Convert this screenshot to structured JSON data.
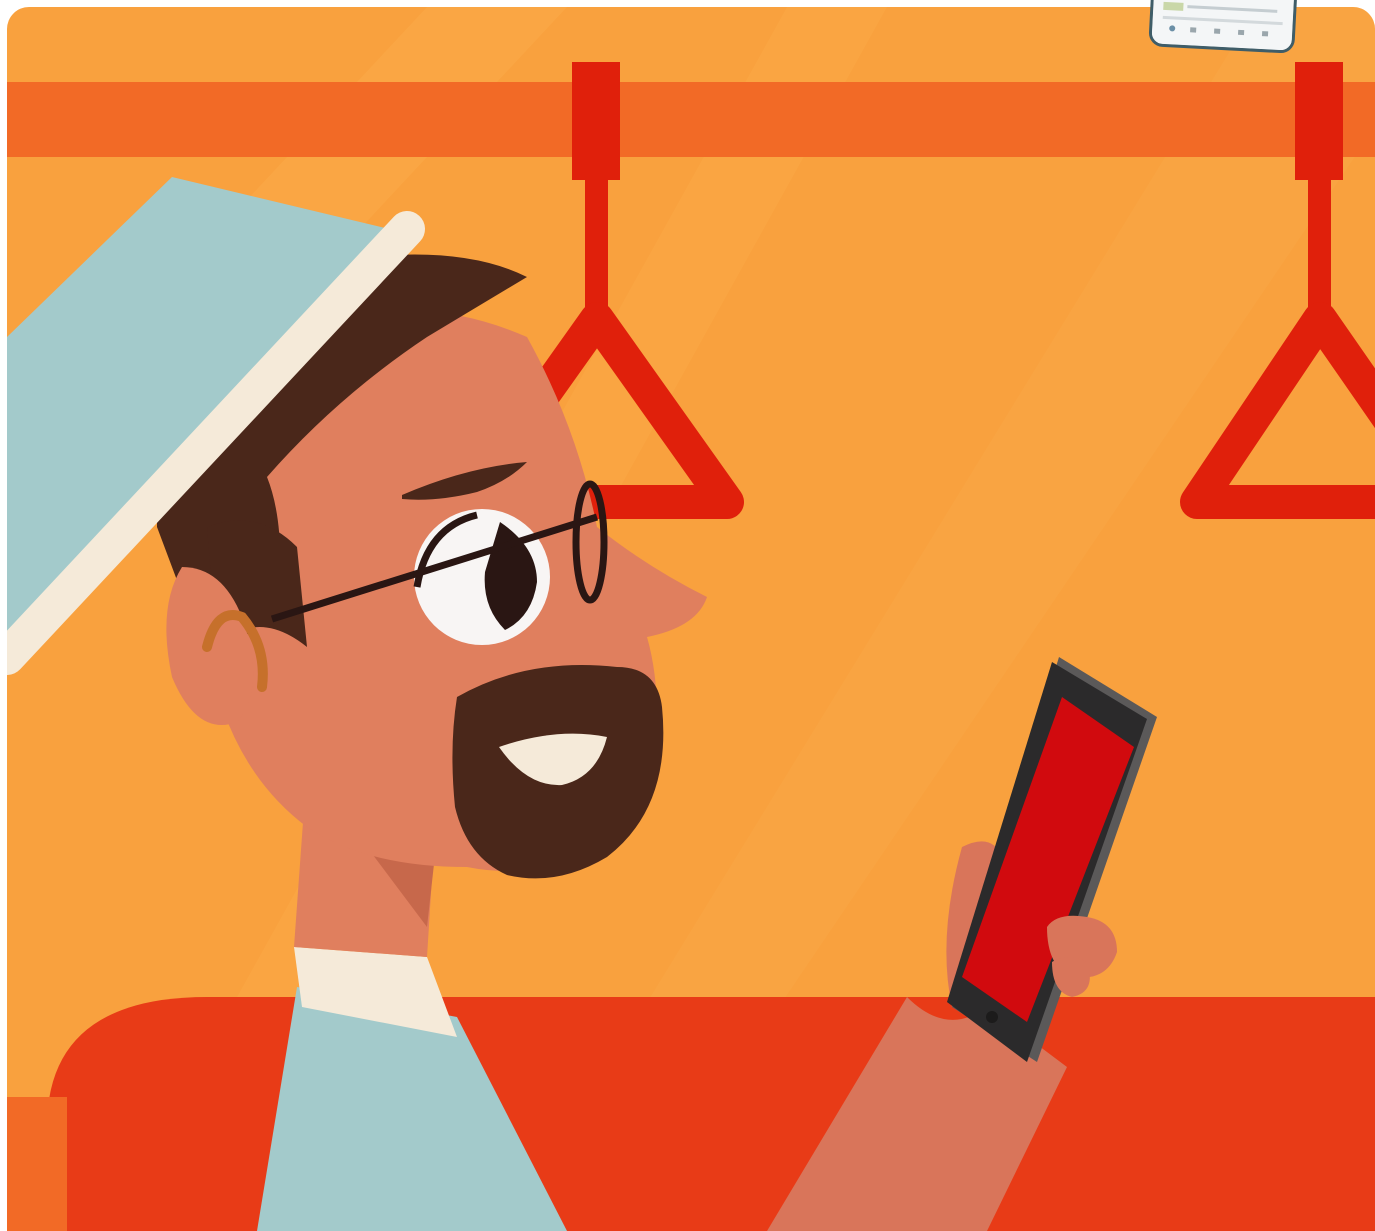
{
  "scene": {
    "subject": "man",
    "colors": {
      "wall": "#f9a13e",
      "wall_stripe": "#fbb04d",
      "rail": "#f26a26",
      "handle": "#e0200b",
      "seat": "#e83b17",
      "skin": "#e07f5e",
      "skin_shadow": "#c7684b",
      "hair": "#4a271a",
      "hat": "#a3cacb",
      "hat_band": "#f5ead9",
      "shirt": "#a3cacb",
      "collar": "#f5ead9",
      "phone_body": "#2b2a2b",
      "phone_screen": "#d10a0e"
    }
  },
  "overlay": {
    "kind": "app-thumbnail",
    "nav_icons": [
      "home-icon",
      "search-icon",
      "list-icon",
      "cart-icon",
      "user-icon"
    ]
  }
}
